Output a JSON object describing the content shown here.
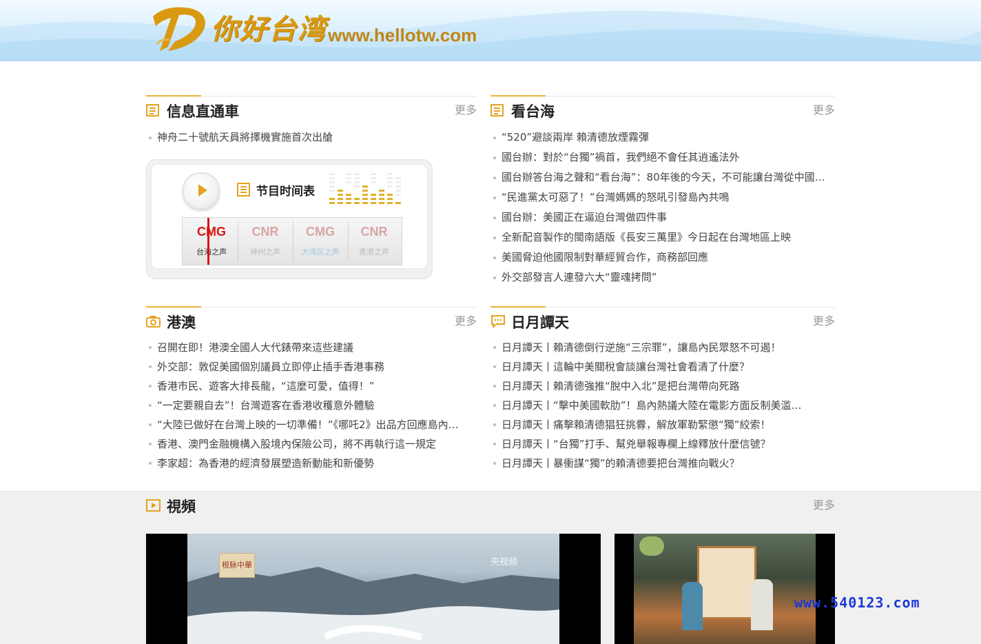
{
  "header": {
    "logo_text": "你好台湾",
    "site_url": "www.hellotw.com"
  },
  "sections": {
    "xinxi": {
      "title": "信息直通車",
      "more": "更多",
      "items": [
        "神舟二十號航天員將擇機實施首次出艙"
      ]
    },
    "kan": {
      "title": "看台海",
      "more": "更多",
      "items": [
        "“520”避談兩岸 賴清德放煙霧彈",
        "國台辦：對於“台獨”禍首，我們絕不會任其逍遙法外",
        "國台辦答台海之聲和“看台海”：80年後的今天，不可能讓台灣從中國…",
        "“民進黨太可惡了！”台灣媽媽的怒吼引發島內共鳴",
        "國台辦：美國正在逼迫台灣做四件事",
        "全新配音製作的閩南語版《長安三萬里》今日起在台灣地區上映",
        "美國脅迫他國限制對華經貿合作，商務部回應",
        "外交部發言人連發六大“靈魂拷問”"
      ]
    },
    "gangao": {
      "title": "港澳",
      "more": "更多",
      "items": [
        "召開在即！港澳全國人大代錶帶來這些建議",
        "外交部：敦促美國個別議員立即停止插手香港事務",
        "香港市民、遊客大排長龍，“這麼可愛，值得！”",
        "“一定要親自去”！台灣遊客在香港收穫意外體驗",
        "“大陸已做好在台灣上映的一切準備！”《哪吒2》出品方回應島內…",
        "香港、澳門金融機構入股境內保險公司，將不再執行這一規定",
        "李家超：為香港的經濟發展塑造新動能和新優勢"
      ]
    },
    "riyue": {
      "title": "日月譚天",
      "more": "更多",
      "items": [
        "日月譚天丨賴清德倒行逆施“三宗罪”，讓島內民眾怒不可遏！",
        "日月譚天丨這輪中美關稅會談讓台灣社會看清了什麼？",
        "日月譚天丨賴清德強推“脫中入北”是把台灣帶向死路",
        "日月譚天丨“擊中美國軟肋”！島內熱議大陸在電影方面反制美滥…",
        "日月譚天丨痛擊賴清德猖狂挑釁，解放軍勒緊懲“獨”絞索！",
        "日月譚天丨“台獨”打手、幫兇舉報專欄上線釋放什麼信號？",
        "日月譚天丨暴衝謀“獨”的賴清德要把台灣推向戰火？"
      ]
    },
    "video": {
      "title": "視頻",
      "more": "更多",
      "main_caption": "根脉中華",
      "tv_brand": "央视频"
    }
  },
  "radio": {
    "schedule_label": "节目时间表",
    "channels": [
      {
        "logo": "CMG",
        "name": "台海之声",
        "color": "#d81414"
      },
      {
        "logo": "CNR",
        "name": "神州之声",
        "color": "#d8a5a5"
      },
      {
        "logo": "CMG",
        "name": "大湾区之声",
        "color": "#d8a5a5"
      },
      {
        "logo": "CNR",
        "name": "香港之声",
        "color": "#d8a5a5"
      }
    ]
  },
  "watermark": "www.540123.com",
  "colors": {
    "accent": "#e9b33a",
    "header_blue": "#c6e6fa",
    "logo_gold": "#d99a12"
  }
}
